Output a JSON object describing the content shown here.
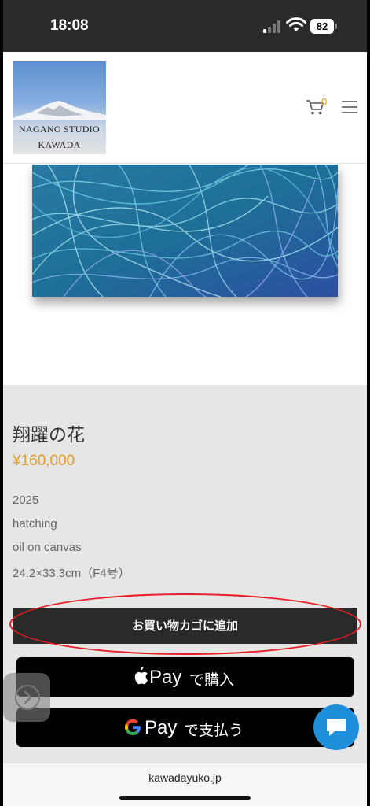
{
  "status_bar": {
    "time": "18:08",
    "battery": "82"
  },
  "header": {
    "logo_line1": "NAGANO STUDIO",
    "logo_line2": "KAWADA",
    "cart_count": "0"
  },
  "product": {
    "title": "翔躍の花",
    "price": "¥160,000",
    "year": "2025",
    "technique": "hatching",
    "medium": "oil on canvas",
    "size": "24.2×33.3cm（F4号）"
  },
  "actions": {
    "add_to_cart": "お買い物カゴに追加",
    "apple_pay_brand": "Pay",
    "apple_pay_label": "で購入",
    "google_pay_brand": "Pay",
    "google_pay_label": "で支払う"
  },
  "browser": {
    "url": "kawadayuko.jp"
  },
  "colors": {
    "price": "#dc9b2a",
    "highlight_ellipse": "#e81c24",
    "chat_button": "#1f8fdc"
  }
}
